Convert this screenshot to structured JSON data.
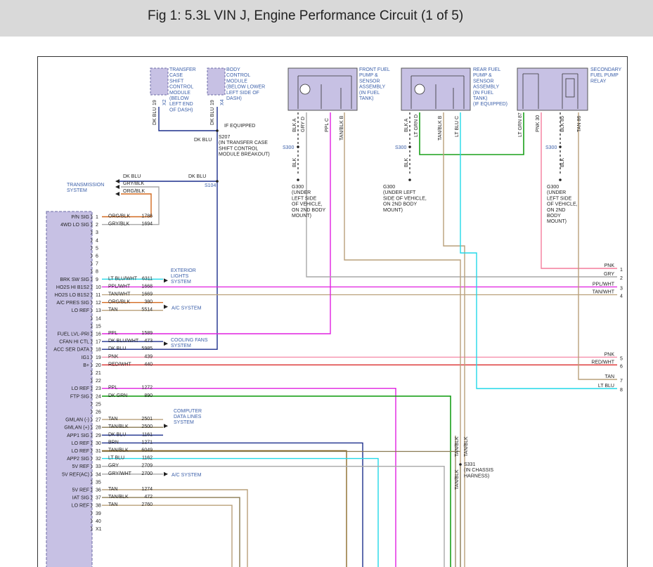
{
  "title": "Fig 1: 5.3L VIN J, Engine Performance Circuit (1 of 5)",
  "colors": {
    "dk_blu": "#1c2f8c",
    "org_blk": "#d2691e",
    "gry": "#a8a8a8",
    "ppl": "#e020e0",
    "tan": "#b9a07a",
    "tan_blk": "#8a7a52",
    "lt_blu": "#22d8e8",
    "grn": "#1aa01a",
    "pnk": "#f47c9c",
    "red": "#d81a1a",
    "brn": "#8b6b2a",
    "label_blue": "#3a5ea8"
  },
  "components": {
    "transfer_case": [
      "TRANSFER",
      "CASE",
      "SHIFT",
      "CONTROL",
      "MODULE",
      "(BELOW",
      "LEFT END",
      "OF DASH)"
    ],
    "body_control": [
      "BODY",
      "CONTROL",
      "MODULE",
      "(BELOW LOWER",
      "LEFT SIDE OF",
      "DASH)"
    ],
    "front_pump": [
      "FRONT FUEL",
      "PUMP &",
      "SENSOR",
      "ASSEMBLY",
      "(IN FUEL",
      "TANK)"
    ],
    "rear_pump": [
      "REAR FUEL",
      "PUMP &",
      "SENSOR",
      "ASSEMBLY",
      "(IN FUEL",
      "TANK)",
      "(IF EQUIPPED)"
    ],
    "secondary_relay": [
      "SECONDARY",
      "FUEL PUMP",
      "RELAY"
    ]
  },
  "vertical_labels": {
    "tc_wire": "DK BLU",
    "tc_pin": "19",
    "tc_conn": "X2",
    "bcm_wire": "DK BLU",
    "bcm_pin": "19",
    "bcm_conn": "X4",
    "fp_a": "BLK A",
    "fp_d": "GRY D",
    "fp_c": "PPL C",
    "fp_b": "TAN/BLK B",
    "rp_a": "BLK A",
    "rp_d": "LT GRN D",
    "rp_b": "TAN/BLK B",
    "rp_c": "LT BLU C",
    "rl_87": "LT GRN 87",
    "rl_30": "PNK 30",
    "rl_85": "BLK 85",
    "rl_86": "TAN 86",
    "blk1": "BLK",
    "blk2": "BLK",
    "blk3": "BLK",
    "tanblk1": "TAN/BLK",
    "tanblk2": "TAN/BLK",
    "tanblk3": "TAN/BLK"
  },
  "splices": {
    "if_equipped": "IF EQUIPPED",
    "dkblu_label": "DK BLU",
    "s207": [
      "S207",
      "(IN TRANSFER CASE",
      "SHIFT CONTROL",
      "MODULE BREAKOUT)"
    ],
    "s104": "S104",
    "s300_1": "S300",
    "s300_2": "S300",
    "s300_3": "S300",
    "g300_1": [
      "G300",
      "(UNDER",
      "LEFT SIDE",
      "OF VEHICLE,",
      "ON 2ND BODY",
      "MOUNT)"
    ],
    "g300_2": [
      "G300",
      "(UNDER LEFT",
      "SIDE OF VEHICLE,",
      "ON 2ND BODY",
      "MOUNT)"
    ],
    "g300_3": [
      "G300",
      "(UNDER",
      "LEFT SIDE",
      "OF VEHICLE,",
      "ON 2ND",
      "BODY",
      "MOUNT)"
    ],
    "s331": [
      "S331",
      "(IN CHASSIS",
      "HARNESS)"
    ]
  },
  "transmission": {
    "label": [
      "TRANSMISSION",
      "SYSTEM"
    ],
    "wires": [
      "DK BLU",
      "GRY/BLK",
      "ORG/BLK"
    ],
    "dkblu_right": "DK BLU"
  },
  "pin_labels": [
    {
      "pin": "1",
      "label": "P/N SIG",
      "wire": "ORG/BLK",
      "circuit": "1786"
    },
    {
      "pin": "2",
      "label": "4WD LO SIG",
      "wire": "GRY/BLK",
      "circuit": "1694"
    },
    {
      "pin": "3",
      "label": "",
      "wire": "",
      "circuit": ""
    },
    {
      "pin": "4",
      "label": "",
      "wire": "",
      "circuit": ""
    },
    {
      "pin": "5",
      "label": "",
      "wire": "",
      "circuit": ""
    },
    {
      "pin": "6",
      "label": "",
      "wire": "",
      "circuit": ""
    },
    {
      "pin": "7",
      "label": "",
      "wire": "",
      "circuit": ""
    },
    {
      "pin": "8",
      "label": "",
      "wire": "",
      "circuit": ""
    },
    {
      "pin": "9",
      "label": "BRK SW SIG",
      "wire": "LT BLU/WHT",
      "circuit": "6311"
    },
    {
      "pin": "10",
      "label": "HO2S HI B1S2",
      "wire": "PPL/WHT",
      "circuit": "1668"
    },
    {
      "pin": "11",
      "label": "HO2S LO B1S2",
      "wire": "TAN/WHT",
      "circuit": "1669"
    },
    {
      "pin": "12",
      "label": "A/C PRES SIG",
      "wire": "ORG/BLK",
      "circuit": "380"
    },
    {
      "pin": "13",
      "label": "LO REF",
      "wire": "TAN",
      "circuit": "5514"
    },
    {
      "pin": "14",
      "label": "",
      "wire": "",
      "circuit": ""
    },
    {
      "pin": "15",
      "label": "",
      "wire": "",
      "circuit": ""
    },
    {
      "pin": "16",
      "label": "FUEL LVL-PRI",
      "wire": "PPL",
      "circuit": "1589"
    },
    {
      "pin": "17",
      "label": "CFAN HI CTL",
      "wire": "DK BLU/WHT",
      "circuit": "473"
    },
    {
      "pin": "18",
      "label": "ACC SER DATA",
      "wire": "DK BLU",
      "circuit": "5985"
    },
    {
      "pin": "19",
      "label": "IG1",
      "wire": "PNK",
      "circuit": "439"
    },
    {
      "pin": "20",
      "label": "B+",
      "wire": "RED/WHT",
      "circuit": "440"
    },
    {
      "pin": "21",
      "label": "",
      "wire": "",
      "circuit": ""
    },
    {
      "pin": "22",
      "label": "",
      "wire": "",
      "circuit": ""
    },
    {
      "pin": "23",
      "label": "LO REF",
      "wire": "PPL",
      "circuit": "1272"
    },
    {
      "pin": "24",
      "label": "FTP SIG",
      "wire": "DK GRN",
      "circuit": "890"
    },
    {
      "pin": "25",
      "label": "",
      "wire": "",
      "circuit": ""
    },
    {
      "pin": "26",
      "label": "",
      "wire": "",
      "circuit": ""
    },
    {
      "pin": "27",
      "label": "GMLAN (-)",
      "wire": "TAN",
      "circuit": "2501"
    },
    {
      "pin": "28",
      "label": "GMLAN (+)",
      "wire": "TAN/BLK",
      "circuit": "2500"
    },
    {
      "pin": "29",
      "label": "APP1 SIG",
      "wire": "DK BLU",
      "circuit": "1161"
    },
    {
      "pin": "30",
      "label": "LO REF",
      "wire": "BRN",
      "circuit": "1271"
    },
    {
      "pin": "31",
      "label": "LO REF",
      "wire": "TAN/BLK",
      "circuit": "6049"
    },
    {
      "pin": "32",
      "label": "APP2 SIG",
      "wire": "LT BLU",
      "circuit": "1162"
    },
    {
      "pin": "33",
      "label": "5V REF",
      "wire": "GRY",
      "circuit": "2709"
    },
    {
      "pin": "34",
      "label": "5V REF(AC)",
      "wire": "GRY/WHT",
      "circuit": "2700"
    },
    {
      "pin": "35",
      "label": "",
      "wire": "",
      "circuit": ""
    },
    {
      "pin": "36",
      "label": "5V REF",
      "wire": "TAN",
      "circuit": "1274"
    },
    {
      "pin": "37",
      "label": "IAT SIG",
      "wire": "TAN/BLK",
      "circuit": "472"
    },
    {
      "pin": "38",
      "label": "LO REF",
      "wire": "TAN",
      "circuit": "2760"
    },
    {
      "pin": "39",
      "label": "",
      "wire": "",
      "circuit": ""
    },
    {
      "pin": "40",
      "label": "",
      "wire": "",
      "circuit": ""
    },
    {
      "pin": "X1",
      "label": "",
      "wire": "",
      "circuit": ""
    }
  ],
  "systems": {
    "exterior_lights": [
      "EXTERIOR",
      "LIGHTS",
      "SYSTEM"
    ],
    "ac_system": "A/C SYSTEM",
    "cooling_fans": [
      "COOLING FANS",
      "SYSTEM"
    ],
    "computer_data": [
      "COMPUTER",
      "DATA LINES",
      "SYSTEM"
    ],
    "ac_system2": "A/C SYSTEM"
  },
  "right_edge": [
    {
      "wire": "PNK",
      "num": "1"
    },
    {
      "wire": "GRY",
      "num": "2"
    },
    {
      "wire": "PPL/WHT",
      "num": "3"
    },
    {
      "wire": "TAN/WHT",
      "num": "4"
    },
    {
      "wire": "PNK",
      "num": "5"
    },
    {
      "wire": "RED/WHT",
      "num": "6"
    },
    {
      "wire": "TAN",
      "num": "7"
    },
    {
      "wire": "LT BLU",
      "num": "8"
    }
  ]
}
